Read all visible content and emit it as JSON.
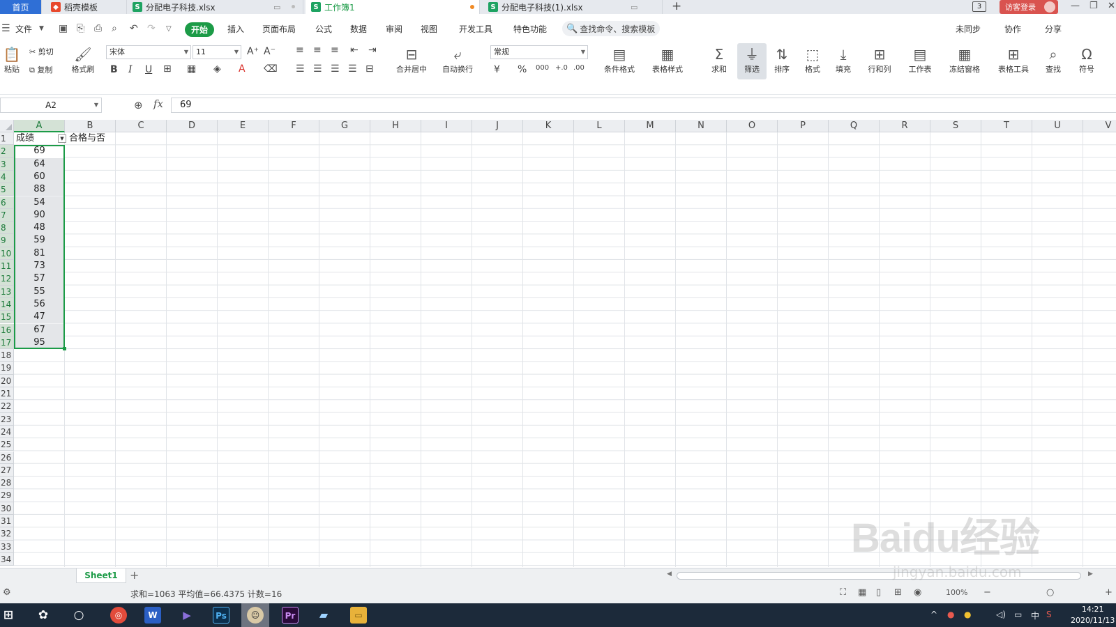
{
  "tabs": {
    "home": "首页",
    "items": [
      {
        "label": "稻壳模板"
      },
      {
        "label": "分配电子科技.xlsx"
      },
      {
        "label": "工作簿1"
      },
      {
        "label": "分配电子科技(1).xlsx"
      }
    ],
    "new_tab": "+",
    "window_count": "3",
    "guest_login": "访客登录"
  },
  "menu": {
    "file": "文件",
    "items": [
      "开始",
      "插入",
      "页面布局",
      "公式",
      "数据",
      "审阅",
      "视图",
      "开发工具",
      "特色功能"
    ],
    "search": "查找命令、搜索模板",
    "right": [
      "未同步",
      "协作",
      "分享"
    ]
  },
  "ribbon": {
    "paste": "粘贴",
    "cut": "剪切",
    "copy": "复制",
    "format_painter": "格式刷",
    "font_name": "宋体",
    "font_size": "11",
    "merge_center": "合并居中",
    "wrap_text": "自动换行",
    "number_format": "常规",
    "conditional_format": "条件格式",
    "table_style": "表格样式",
    "sum": "求和",
    "filter": "筛选",
    "sort": "排序",
    "format": "格式",
    "fill": "填充",
    "row_col": "行和列",
    "worksheet": "工作表",
    "freeze": "冻结窗格",
    "table_tools": "表格工具",
    "find": "查找",
    "symbol": "符号"
  },
  "formula_bar": {
    "cell_ref": "A2",
    "fx": "fx",
    "value": "69"
  },
  "sheet": {
    "columns": [
      "A",
      "B",
      "C",
      "D",
      "E",
      "F",
      "G",
      "H",
      "I",
      "J",
      "K",
      "L",
      "M",
      "N",
      "O",
      "P",
      "Q",
      "R",
      "S",
      "T",
      "U",
      "V"
    ],
    "rows": [
      "1",
      "2",
      "3",
      "4",
      "5",
      "6",
      "7",
      "8",
      "9",
      "10",
      "11",
      "12",
      "13",
      "14",
      "15",
      "16",
      "17",
      "18",
      "19",
      "20",
      "21",
      "22",
      "23",
      "24",
      "25",
      "26",
      "27",
      "28",
      "29",
      "30",
      "31",
      "32",
      "33",
      "34"
    ],
    "header_a": "成绩",
    "header_b": "合格与否",
    "scores": [
      "69",
      "64",
      "60",
      "88",
      "54",
      "90",
      "48",
      "59",
      "81",
      "73",
      "57",
      "55",
      "56",
      "47",
      "67",
      "95"
    ]
  },
  "sheet_tabs": {
    "active": "Sheet1",
    "add": "+"
  },
  "status": {
    "text": "求和=1063  平均值=66.4375  计数=16",
    "zoom": "100%"
  },
  "taskbar": {
    "tray_lang": "中",
    "time": "14:21",
    "date": "2020/11/13"
  },
  "watermark": {
    "logo": "Baidu经验",
    "url": "jingyan.baidu.com"
  }
}
